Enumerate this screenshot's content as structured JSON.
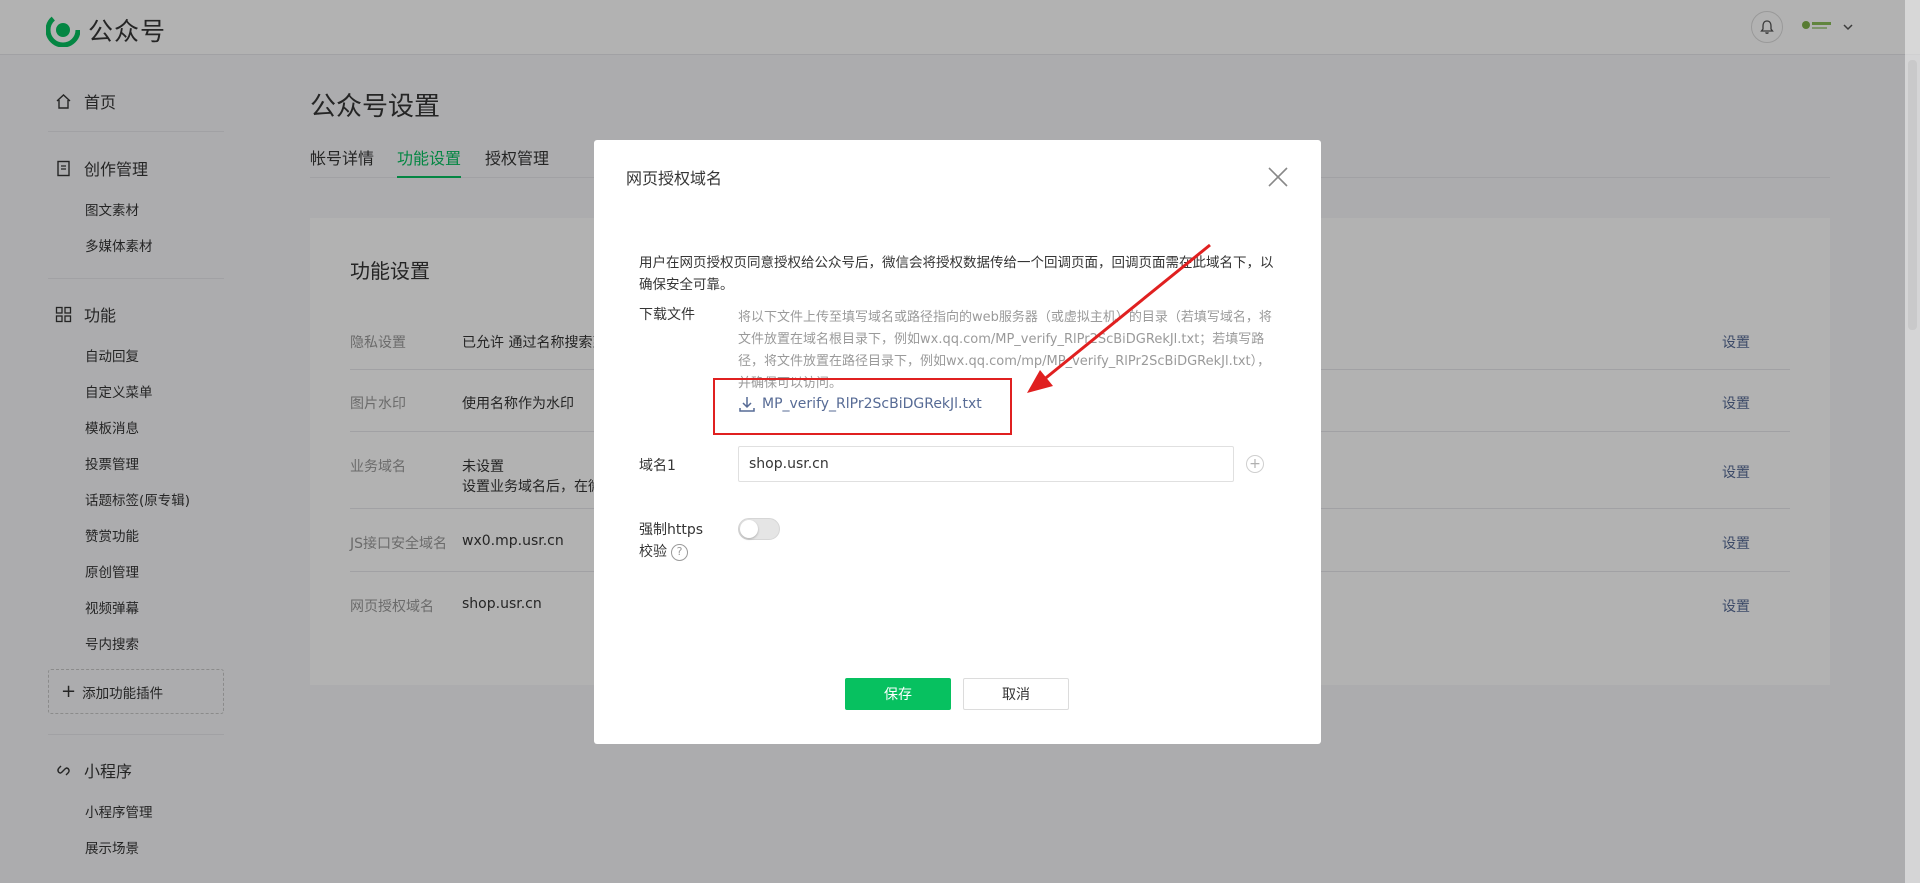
{
  "app": {
    "logo_text": "公众号",
    "brand_color": "#07c160"
  },
  "header": {
    "icons": [
      "bell-icon",
      "avatar",
      "chevron-down-icon"
    ]
  },
  "sidebar": {
    "groups": [
      {
        "label": "首页",
        "icon": "home-icon",
        "items": []
      },
      {
        "label": "创作管理",
        "icon": "document-icon",
        "items": [
          "图文素材",
          "多媒体素材"
        ]
      },
      {
        "label": "功能",
        "icon": "grid-icon",
        "items": [
          "自动回复",
          "自定义菜单",
          "模板消息",
          "投票管理",
          "话题标签(原专辑)",
          "赞赏功能",
          "原创管理",
          "视频弹幕",
          "号内搜索"
        ]
      },
      {
        "label": "小程序",
        "icon": "link-icon",
        "items": [
          "小程序管理",
          "展示场景"
        ]
      }
    ],
    "add_plugin_label": "添加功能插件"
  },
  "main": {
    "page_title": "公众号设置",
    "tabs": [
      {
        "label": "帐号详情",
        "active": false
      },
      {
        "label": "功能设置",
        "active": true
      },
      {
        "label": "授权管理",
        "active": false
      }
    ],
    "panel_title": "功能设置",
    "rows": [
      {
        "label": "隐私设置",
        "value": "已允许 通过名称搜索到",
        "value2": "",
        "action": "设置"
      },
      {
        "label": "图片水印",
        "value": "使用名称作为水印",
        "value2": "",
        "action": "设置"
      },
      {
        "label": "业务域名",
        "value": "未设置",
        "value2": "设置业务域名后，在微",
        "action": "设置"
      },
      {
        "label": "JS接口安全域名",
        "value": "wx0.mp.usr.cn",
        "value2": "",
        "action": "设置"
      },
      {
        "label": "网页授权域名",
        "value": "shop.usr.cn",
        "value2": "",
        "action": "设置"
      }
    ]
  },
  "dialog": {
    "title": "网页授权域名",
    "description": "用户在网页授权页同意授权给公众号后，微信会将授权数据传给一个回调页面，回调页面需在此域名下，以确保安全可靠。",
    "download_label": "下载文件",
    "download_hint": "将以下文件上传至填写域名或路径指向的web服务器（或虚拟主机）的目录（若填写域名，将文件放置在域名根目录下，例如wx.qq.com/MP_verify_RlPr2ScBiDGRekJl.txt；若填写路径，将文件放置在路径目录下，例如wx.qq.com/mp/MP_verify_RlPr2ScBiDGRekJl.txt），并确保可以访问。",
    "download_file": "MP_verify_RlPr2ScBiDGRekJl.txt",
    "domain_label": "域名1",
    "domain_value": "shop.usr.cn",
    "https_label_line1": "强制https",
    "https_label_line2": "校验",
    "https_enabled": false,
    "save_label": "保存",
    "cancel_label": "取消",
    "annotation_color": "#e02020"
  }
}
